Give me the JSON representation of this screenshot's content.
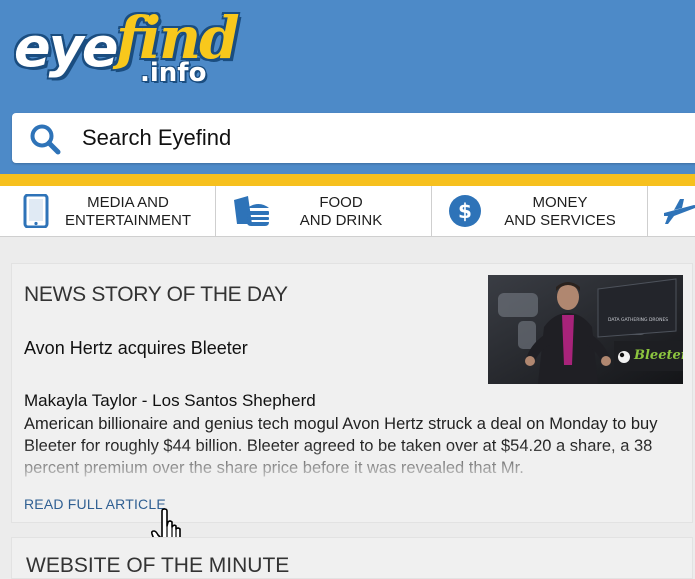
{
  "logo": {
    "part1": "eye",
    "part2": "find",
    "part3": ".info"
  },
  "search": {
    "placeholder": "Search Eyefind"
  },
  "categories": [
    {
      "label": "MEDIA AND\nENTERTAINMENT",
      "icon": "tablet-icon"
    },
    {
      "label": "FOOD\nAND DRINK",
      "icon": "burger-icon"
    },
    {
      "label": "MONEY\nAND SERVICES",
      "icon": "dollar-icon"
    },
    {
      "label": "",
      "icon": "airplane-icon"
    }
  ],
  "news": {
    "section_title": "NEWS STORY OF THE DAY",
    "headline": "Avon Hertz acquires Bleeter",
    "author": "Makayla Taylor - Los Santos Shepherd",
    "body": "American billionaire and genius tech mogul Avon Hertz struck a deal on Monday to buy Bleeter for roughly $44 billion. Bleeter agreed to be taken over at $54.20 a share, a 38 percent premium over the share price before it was revealed that Mr.",
    "read_more": "READ FULL ARTICLE",
    "image_caption": "Bleeter",
    "image_banner": "DATA GATHERING DRONES"
  },
  "next_section": {
    "title": "WEBSITE OF THE MINUTE"
  },
  "colors": {
    "header": "#4d8ac8",
    "accent_yellow": "#f6c01e",
    "icon_blue": "#2e73b8"
  }
}
